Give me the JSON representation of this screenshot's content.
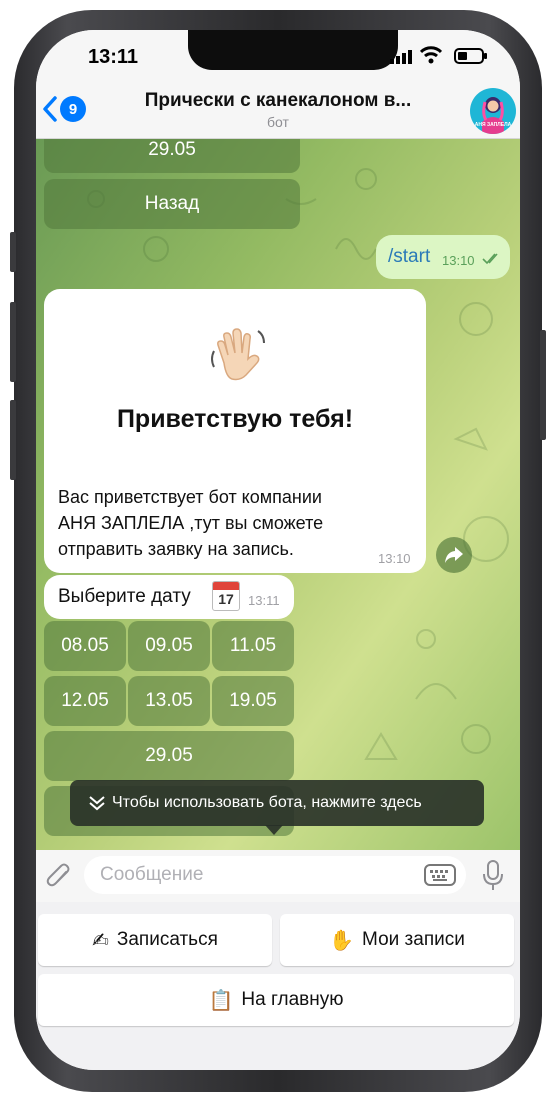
{
  "status": {
    "time": "13:11"
  },
  "header": {
    "back_count": "9",
    "title": "Прически с канекалоном в...",
    "subtitle": "бот",
    "avatar_text": "АНЯ ЗАПЛЕЛА"
  },
  "chat": {
    "top_keyboard": {
      "date_button": "29.05",
      "back_button": "Назад"
    },
    "outgoing": {
      "text": "/start",
      "time": "13:10"
    },
    "welcome": {
      "heading": "Приветствую тебя!",
      "lines": [
        "Вас приветствует бот компании",
        "АНЯ ЗАПЛЕЛА ,тут вы сможете",
        "отправить заявку на запись."
      ],
      "time": "13:10"
    },
    "select_date": {
      "text": "Выберите дату",
      "calendar_day": "17",
      "time": "13:11"
    },
    "date_keyboard": [
      "08.05",
      "09.05",
      "11.05",
      "12.05",
      "13.05",
      "19.05",
      "29.05"
    ],
    "tooltip": "Чтобы использовать бота, нажмите здесь"
  },
  "input": {
    "placeholder": "Сообщение"
  },
  "reply_keyboard": {
    "book_label": "Записаться",
    "my_bookings_label": "Мои записи",
    "home_label": "На главную"
  },
  "colors": {
    "accent": "#007aff",
    "bubble_out": "#dcf6c4",
    "chat_green": "#93ba62"
  }
}
